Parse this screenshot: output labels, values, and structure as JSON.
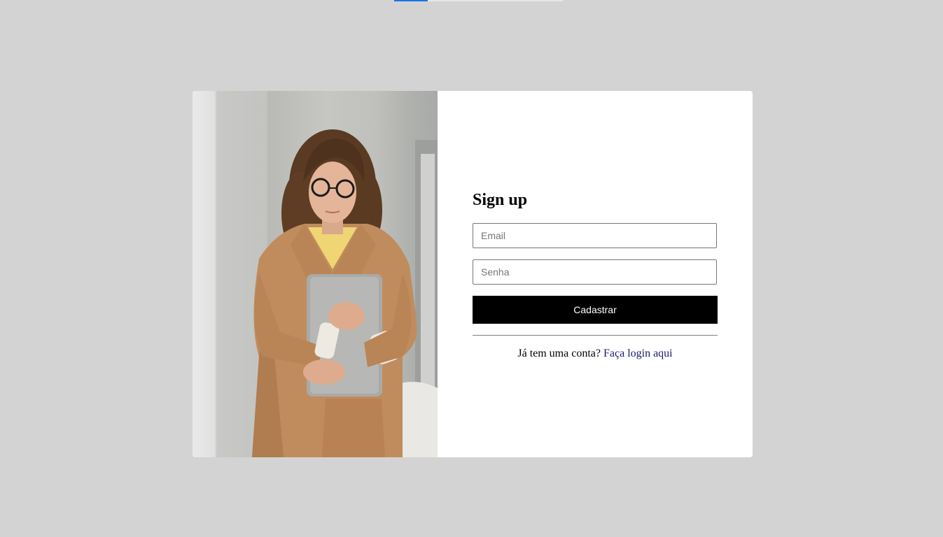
{
  "form": {
    "title": "Sign up",
    "email_placeholder": "Email",
    "password_placeholder": "Senha",
    "submit_label": "Cadastrar",
    "login_prompt": "Já tem uma conta?",
    "login_link": "Faça login aqui"
  },
  "colors": {
    "page_background": "#d3d3d3",
    "card_background": "#ffffff",
    "button_background": "#000000",
    "button_text": "#ffffff",
    "link": "#1a1a6e",
    "progress_accent": "#1a73e8"
  },
  "images": {
    "hero": "woman-holding-laptop-photo"
  }
}
